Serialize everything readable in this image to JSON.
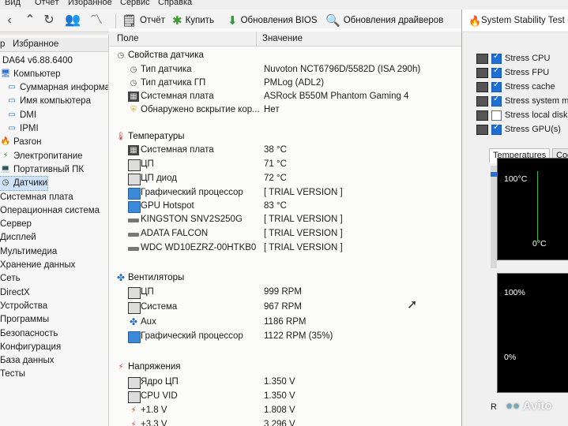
{
  "menu": {
    "items": [
      "Вид",
      "Отчёт",
      "Избранное",
      "Сервис",
      "Справка"
    ]
  },
  "toolbar": {
    "report_label": "Отчёт",
    "buy_label": "Купить",
    "bios_label": "Обновления BIOS",
    "drivers_label": "Обновления драйверов"
  },
  "left_panel": {
    "tab_menu": "р",
    "tab_favorites": "Избранное",
    "items": [
      {
        "label": "DA64 v6.88.6400",
        "icon": "aida-logo-icon"
      },
      {
        "label": "Компьютер",
        "icon": "computer-icon"
      },
      {
        "label": "Суммарная информация",
        "icon": "monitor-icon"
      },
      {
        "label": "Имя компьютера",
        "icon": "monitor-icon"
      },
      {
        "label": "DMI",
        "icon": "monitor-icon"
      },
      {
        "label": "IPMI",
        "icon": "monitor-icon"
      },
      {
        "label": "Разгон",
        "icon": "fire-icon"
      },
      {
        "label": "Электропитание",
        "icon": "power-icon"
      },
      {
        "label": "Портативный ПК",
        "icon": "laptop-icon"
      },
      {
        "label": "Датчики",
        "icon": "gauge-icon"
      },
      {
        "label": "Системная плата",
        "icon": ""
      },
      {
        "label": "Операционная система",
        "icon": ""
      },
      {
        "label": "Сервер",
        "icon": ""
      },
      {
        "label": "Дисплей",
        "icon": ""
      },
      {
        "label": "Мультимедиа",
        "icon": ""
      },
      {
        "label": "Хранение данных",
        "icon": ""
      },
      {
        "label": "Сеть",
        "icon": ""
      },
      {
        "label": "DirectX",
        "icon": ""
      },
      {
        "label": "Устройства",
        "icon": ""
      },
      {
        "label": "Программы",
        "icon": ""
      },
      {
        "label": "Безопасность",
        "icon": ""
      },
      {
        "label": "Конфигурация",
        "icon": ""
      },
      {
        "label": "База данных",
        "icon": ""
      },
      {
        "label": "Тесты",
        "icon": ""
      }
    ]
  },
  "main": {
    "col_field": "Поле",
    "col_value": "Значение",
    "sensor_props": {
      "title": "Свойства датчика",
      "rows": [
        {
          "field": "Тип датчика",
          "value": "Nuvoton NCT6796D/5582D  (ISA 290h)"
        },
        {
          "field": "Тип датчика ГП",
          "value": "PMLog  (ADL2)"
        },
        {
          "field": "Системная плата",
          "value": "ASRock B550M Phantom Gaming 4"
        },
        {
          "field": "Обнаружено вскрытие кор...",
          "value": "Нет"
        }
      ]
    },
    "temperatures": {
      "title": "Температуры",
      "rows": [
        {
          "field": "Системная плата",
          "value": "38 °C"
        },
        {
          "field": "ЦП",
          "value": "71 °C"
        },
        {
          "field": "ЦП диод",
          "value": "72 °C"
        },
        {
          "field": "Графический процессор",
          "value": "[ TRIAL VERSION ]"
        },
        {
          "field": "GPU Hotspot",
          "value": "83 °C"
        },
        {
          "field": "KINGSTON SNV2S250G",
          "value": "[ TRIAL VERSION ]"
        },
        {
          "field": "ADATA FALCON",
          "value": "[ TRIAL VERSION ]"
        },
        {
          "field": "WDC WD10EZRZ-00HTKB0",
          "value": "[ TRIAL VERSION ]"
        }
      ]
    },
    "fans": {
      "title": "Вентиляторы",
      "rows": [
        {
          "field": "ЦП",
          "value": "999 RPM"
        },
        {
          "field": "Система",
          "value": "967 RPM"
        },
        {
          "field": "Aux",
          "value": "1186 RPM"
        },
        {
          "field": "Графический процессор",
          "value": "1122 RPM  (35%)"
        }
      ]
    },
    "voltages": {
      "title": "Напряжения",
      "rows": [
        {
          "field": "Ядро ЦП",
          "value": "1.350 V"
        },
        {
          "field": "CPU VID",
          "value": "1.350 V"
        },
        {
          "field": "+1.8 V",
          "value": "1.808 V"
        },
        {
          "field": "+3.3 V",
          "value": "3.296 V"
        }
      ]
    }
  },
  "stability": {
    "title": "System Stability Test - A",
    "checks": [
      {
        "label": "Stress CPU",
        "checked": true
      },
      {
        "label": "Stress FPU",
        "checked": true
      },
      {
        "label": "Stress cache",
        "checked": true
      },
      {
        "label": "Stress system m",
        "checked": true
      },
      {
        "label": "Stress local disk",
        "checked": false
      },
      {
        "label": "Stress GPU(s)",
        "checked": true
      }
    ],
    "tab_temperatures": "Temperatures",
    "tab_cooling": "Cool",
    "graph1_top": "100°C",
    "graph1_bottom": "0°C",
    "graph2_top": "100%",
    "graph2_bottom": "0%",
    "bottom_label": "R"
  },
  "watermark": "Avito"
}
